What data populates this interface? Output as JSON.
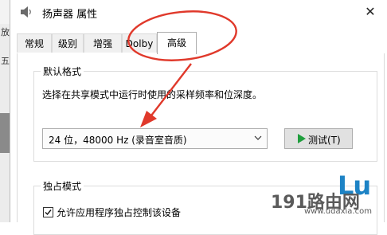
{
  "background": {
    "glyphs": [
      "放",
      "五"
    ]
  },
  "window": {
    "title": "扬声器 属性",
    "close_glyph": "✕"
  },
  "tabs": [
    {
      "label": "常规",
      "active": false
    },
    {
      "label": "级别",
      "active": false
    },
    {
      "label": "增强",
      "active": false
    },
    {
      "label": "Dolby",
      "active": false
    },
    {
      "label": "高级",
      "active": true
    }
  ],
  "default_format": {
    "group_label": "默认格式",
    "description": "选择在共享模式中运行时使用的采样频率和位深度。",
    "selected_format": "24 位，48000 Hz (录音室音质)",
    "test_button": "测试(T)"
  },
  "exclusive_mode": {
    "group_label": "独占模式",
    "checkbox_label": "允许应用程序独占控制该设备",
    "checked": true
  },
  "annotation": {
    "color": "#e0392b"
  },
  "watermark": {
    "logo": "Lu",
    "text": "191路由网",
    "url": "www.udaxia.com"
  }
}
